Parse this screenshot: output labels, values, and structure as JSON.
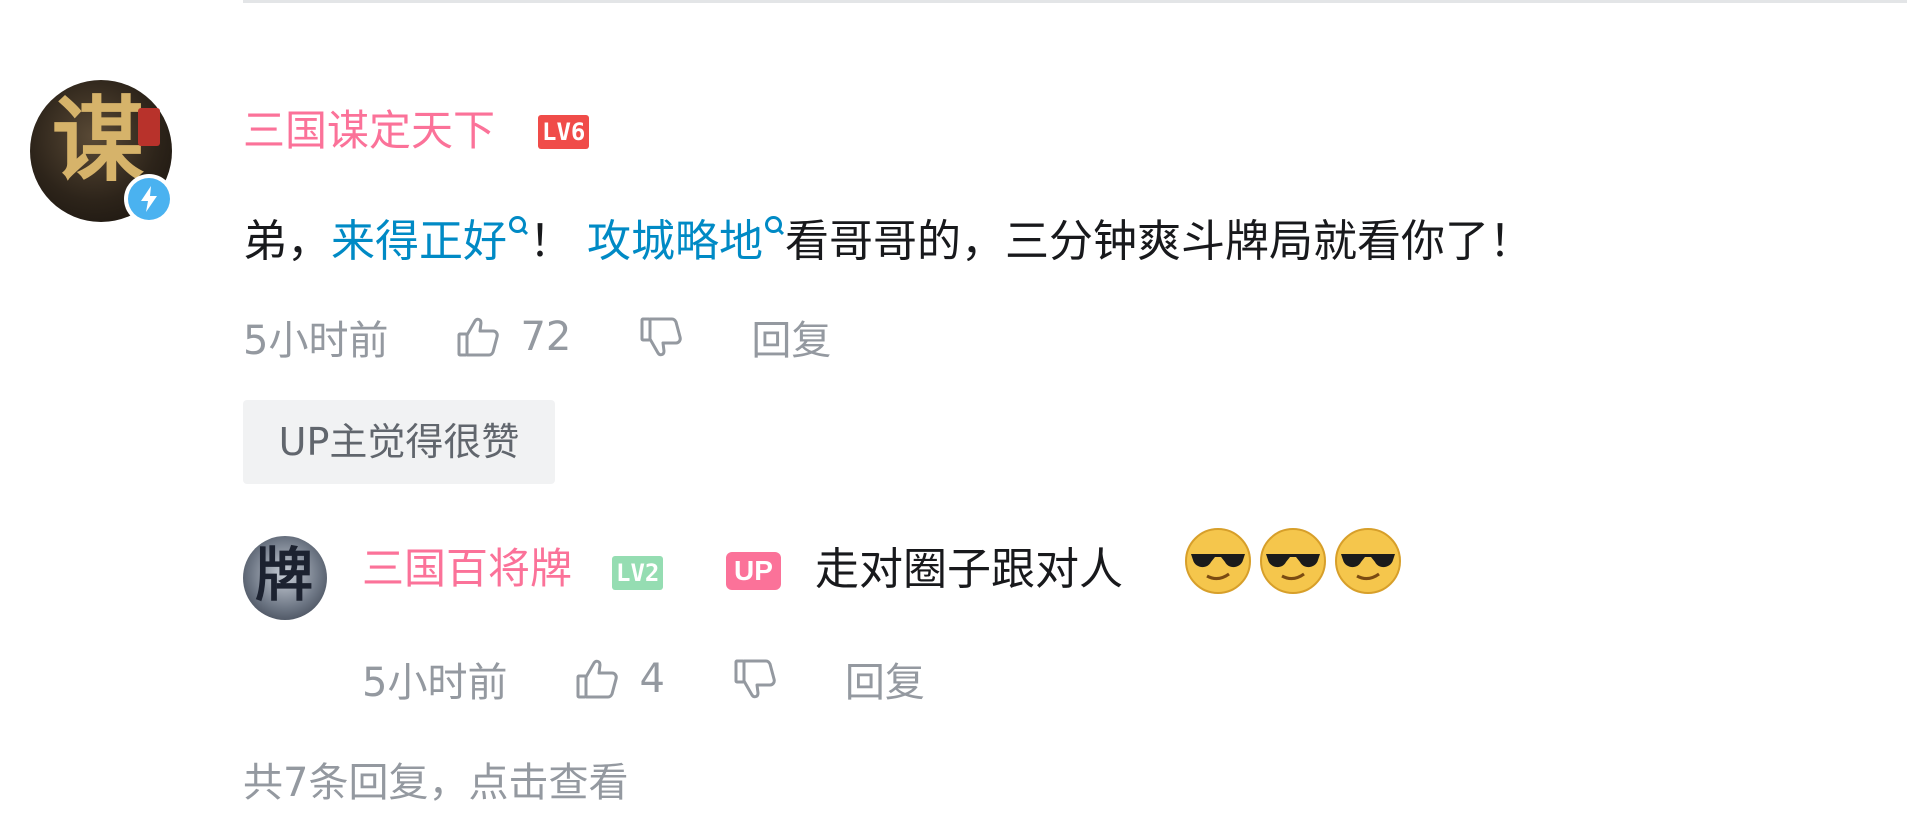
{
  "comment": {
    "author": "三国谋定天下",
    "level": "LV6",
    "avatar_glyph": "谋",
    "content_parts": {
      "p1": "弟，",
      "link1": "来得正好",
      "p2": "！",
      "link2": "攻城略地",
      "p3": "看哥哥的，三分钟爽斗牌局就看你了！"
    },
    "time": "5小时前",
    "likes": "72",
    "reply_label": "回复",
    "up_tag": "UP主觉得很赞",
    "link_color": "#008ac5"
  },
  "reply": {
    "author": "三国百将牌",
    "level": "LV2",
    "up_badge": "UP",
    "avatar_glyph": "牌",
    "content": "走对圈子跟对人",
    "emoji_name": "cool-sunglasses-emoji",
    "emoji_count": 3,
    "time": "5小时前",
    "likes": "4",
    "reply_label": "回复"
  },
  "view_more": "共7条回复，点击查看",
  "colors": {
    "username": "#fb7299",
    "meta": "#9499a0",
    "text": "#18191c"
  }
}
